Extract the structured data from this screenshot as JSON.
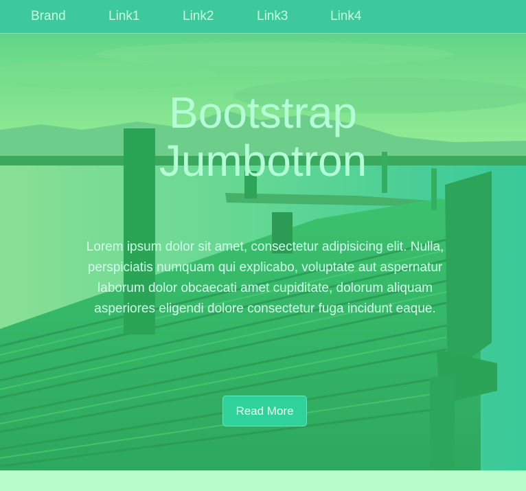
{
  "navbar": {
    "brand": "Brand",
    "links": [
      "Link1",
      "Link2",
      "Link3",
      "Link4"
    ]
  },
  "hero": {
    "title_line1": "Bootstrap",
    "title_line2": "Jumbotron",
    "text": "Lorem ipsum dolor sit amet, consectetur adipisicing elit. Nulla, perspiciatis numquam qui explicabo, voluptate aut aspernatur laborum dolor obcaecati amet cupiditate, dolorum aliquam asperiores eligendi dolore consectetur fuga incidunt eaque.",
    "button_label": "Read More"
  },
  "colors": {
    "navbar_bg": "#3ec99c",
    "hero_tint": "#2fd27a",
    "button_bg": "#2fd29a",
    "page_bg": "#b8fccb"
  }
}
